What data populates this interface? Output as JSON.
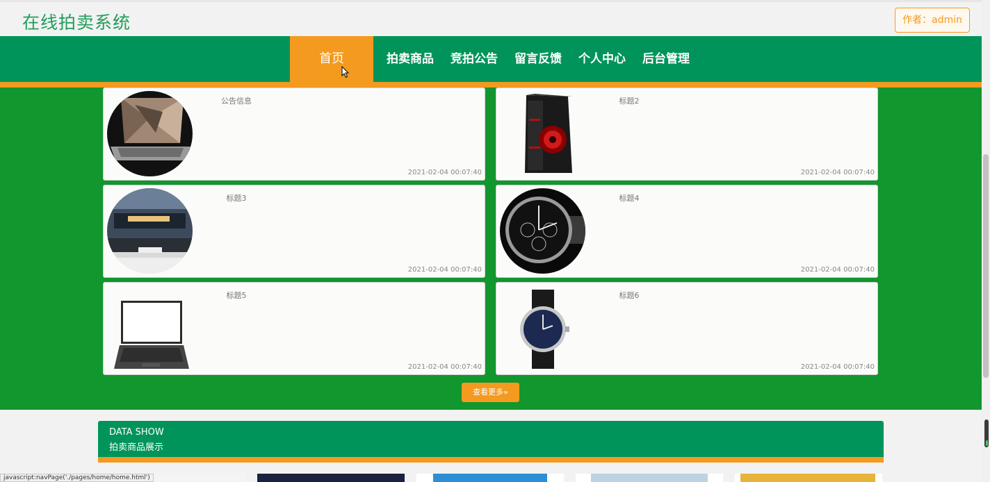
{
  "header": {
    "title": "在线拍卖系统",
    "author_label": "作者：admin"
  },
  "nav": {
    "items": [
      {
        "label": "首页",
        "active": true
      },
      {
        "label": "拍卖商品",
        "active": false
      },
      {
        "label": "竞拍公告",
        "active": false
      },
      {
        "label": "留言反馈",
        "active": false
      },
      {
        "label": "个人中心",
        "active": false
      },
      {
        "label": "后台管理",
        "active": false
      }
    ]
  },
  "notices": [
    {
      "title": "公告信息",
      "date": "2021-02-04 00:07:40",
      "image": "laptop-photo"
    },
    {
      "title": "标题2",
      "date": "2021-02-04 00:07:40",
      "image": "pc-case-photo"
    },
    {
      "title": "标题3",
      "date": "2021-02-04 00:07:40",
      "image": "tv-photo"
    },
    {
      "title": "标题4",
      "date": "2021-02-04 00:07:40",
      "image": "chronograph-watch-photo"
    },
    {
      "title": "标题5",
      "date": "2021-02-04 00:07:40",
      "image": "laptop-photo"
    },
    {
      "title": "标题6",
      "date": "2021-02-04 00:07:40",
      "image": "wristwatch-photo"
    }
  ],
  "more_button": "查看更多»",
  "data_show": {
    "title_en": "DATA SHOW",
    "title_cn": "拍卖商品展示"
  },
  "status_bar": "javascript:navPage('./pages/home/home.html')",
  "colors": {
    "primary_green": "#00945a",
    "section_green": "#12962e",
    "accent_orange": "#f39a1f"
  }
}
